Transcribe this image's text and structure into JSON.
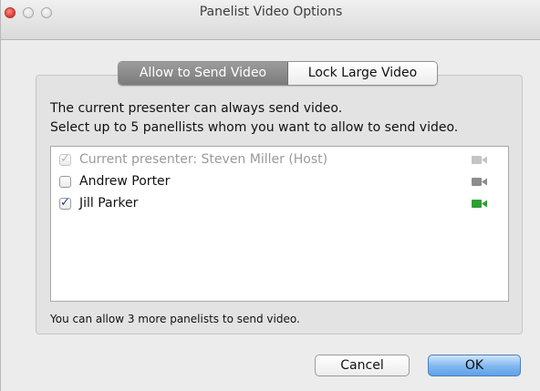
{
  "window": {
    "title": "Panelist Video Options"
  },
  "tabs": [
    {
      "label": "Allow to Send Video",
      "selected": true
    },
    {
      "label": "Lock Large Video",
      "selected": false
    }
  ],
  "description": {
    "line1": "The current presenter can always send video.",
    "line2": "Select up to 5 panellists whom you want to allow to send video."
  },
  "panelists": [
    {
      "label": "Current presenter: Steven Miller (Host)",
      "checked": true,
      "disabled": true,
      "camera_color": "#c4c4c4"
    },
    {
      "label": "Andrew Porter",
      "checked": false,
      "disabled": false,
      "camera_color": "#8c8c8c"
    },
    {
      "label": "Jill Parker",
      "checked": true,
      "disabled": false,
      "camera_color": "#2f9e33"
    }
  ],
  "footnote": "You can allow 3 more panelists to send video.",
  "buttons": {
    "cancel_label": "Cancel",
    "ok_label": "OK"
  },
  "colors": {
    "close_button": "#e0443a",
    "default_button": "#7fb6ef",
    "camera_active": "#2f9e33"
  },
  "icons": {
    "checkmark": "✓",
    "camera": "video-camera-icon"
  }
}
